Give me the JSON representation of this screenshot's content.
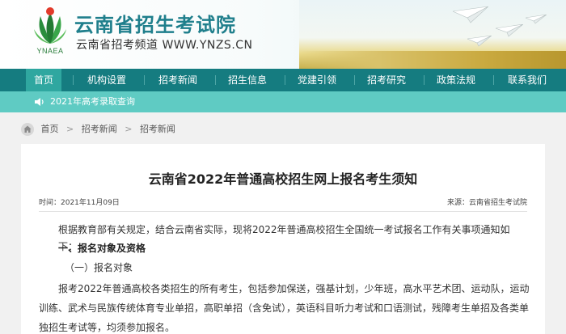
{
  "site": {
    "title": "云南省招生考试院",
    "subtitle": "云南省招考频道 WWW.YNZS.CN",
    "logo_text": "YNAEA"
  },
  "nav": {
    "items": [
      "首页",
      "机构设置",
      "招考新闻",
      "招生信息",
      "党建引领",
      "招考研究",
      "政策法规",
      "联系我们"
    ],
    "active_index": 0
  },
  "notice": {
    "icon": "speaker-icon",
    "text": "2021年高考录取查询"
  },
  "breadcrumb": {
    "icon": "home-icon",
    "items": [
      "首页",
      "招考新闻",
      "招考新闻"
    ],
    "separator": ">"
  },
  "article": {
    "title": "云南省2022年普通高校招生网上报名考生须知",
    "date": "时间：2021年11月09日",
    "source": "来源：云南省招生考试院",
    "intro": "根据教育部有关规定，结合云南省实际，现将2022年普通高校招生全国统一考试报名工作有关事项通知如下：",
    "section_heading": "一、报名对象及资格",
    "subsection": "（一）报名对象",
    "body": "报考2022年普通高校各类招生的所有考生，包括参加保送，强基计划，少年班，高水平艺术团、运动队，运动训练、武术与民族传统体育专业单招，高职单招（含免试），英语科目听力考试和口语测试，残障考生单招及各类单独招生考试等，均须参加报名。"
  },
  "colors": {
    "nav_bg": "#157c80",
    "nav_active": "#2fa7a0",
    "notice_bg": "#5fcbc3",
    "title_teal": "#1f7f8c"
  }
}
